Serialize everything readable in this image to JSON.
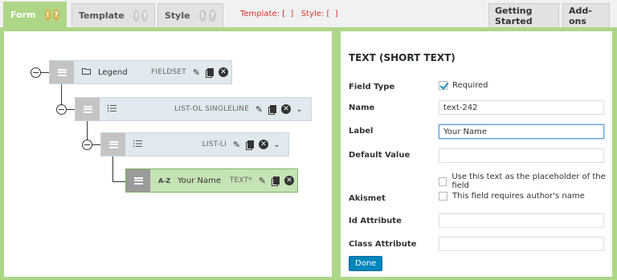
{
  "tabs": {
    "form": {
      "label": "Form"
    },
    "template": {
      "label": "Template"
    },
    "style": {
      "label": "Style"
    },
    "info": {
      "warning_glyph": "!",
      "help_glyph": "?"
    },
    "template_status": "Template: [  ]   Style: [  ]",
    "getting_started": "Getting Started",
    "addons": "Add-ons"
  },
  "colors": {
    "accent_green": "#aed687",
    "node_blue": "#dfe9ee",
    "node_selected": "#c6e3b6",
    "button_blue": "#0085ba",
    "status_red": "#dc3232"
  },
  "tree": {
    "nodes": [
      {
        "icon": "folder-icon",
        "title": "Legend",
        "type": "FIELDSET"
      },
      {
        "icon": "ordered-list-icon",
        "title": "",
        "type": "LIST-OL  SINGLELINE"
      },
      {
        "icon": "unordered-list-icon",
        "title": "",
        "type": "LIST-LI"
      },
      {
        "icon": "text-az-icon",
        "title": "Your Name",
        "type": "TEXT*",
        "az_glyph": "A-Z"
      }
    ]
  },
  "settings": {
    "title": "TEXT (SHORT TEXT)",
    "field_type_label": "Field Type",
    "required_label": "Required",
    "required_checked": true,
    "name_label": "Name",
    "name_value": "text-242",
    "label_label": "Label",
    "label_value": "Your Name",
    "default_value_label": "Default Value",
    "default_value": "",
    "placeholder_option": "Use this text as the placeholder of the field",
    "akismet_label": "Akismet",
    "akismet_option": "This field requires author's name",
    "id_attribute_label": "Id Attribute",
    "id_attribute_value": "",
    "class_attribute_label": "Class Attribute",
    "class_attribute_value": "",
    "done_label": "Done"
  }
}
